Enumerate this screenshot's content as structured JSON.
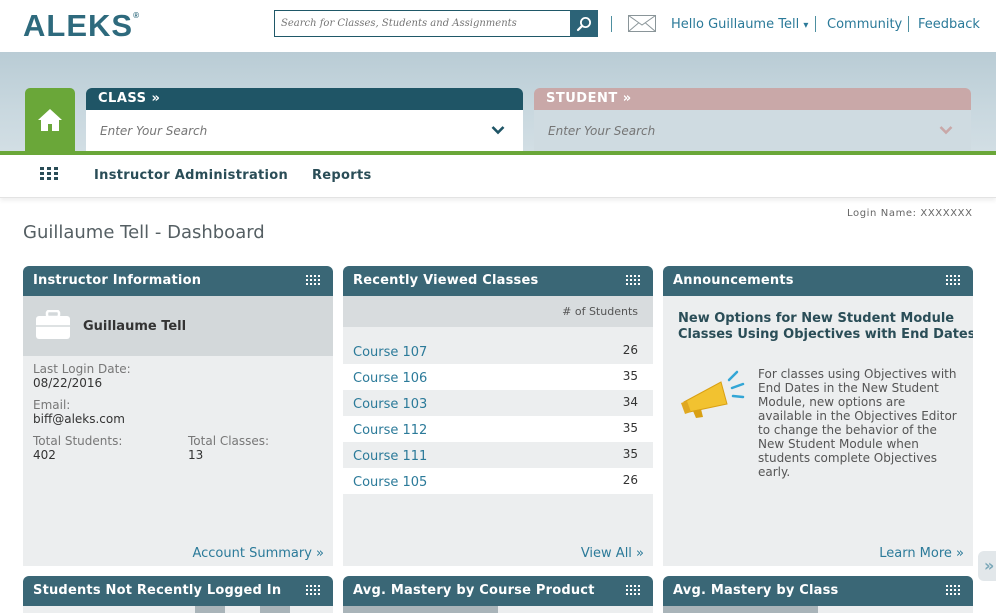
{
  "header": {
    "logo": "ALEKS",
    "logo_mark": "®",
    "search_placeholder": "Search for Classes, Students and Assignments",
    "greeting": "Hello Guillaume Tell",
    "greeting_caret": "▾",
    "community": "Community",
    "feedback": "Feedback"
  },
  "banner": {
    "class_label": "CLASS »",
    "class_placeholder": "Enter Your Search",
    "student_label": "STUDENT »",
    "student_placeholder": "Enter Your Search"
  },
  "nav": {
    "items": [
      "Instructor Administration",
      "Reports"
    ]
  },
  "login_name": "Login Name: XXXXXXX",
  "page_title": "Guillaume Tell - Dashboard",
  "instructor_panel": {
    "title": "Instructor Information",
    "name": "Guillaume Tell",
    "last_login_label": "Last Login Date:",
    "last_login_value": "08/22/2016",
    "email_label": "Email:",
    "email_value": "biff@aleks.com",
    "total_students_label": "Total Students:",
    "total_students_value": "402",
    "total_classes_label": "Total Classes:",
    "total_classes_value": "13",
    "footer_link": "Account Summary »"
  },
  "classes_panel": {
    "title": "Recently Viewed Classes",
    "column_header": "# of Students",
    "rows": [
      {
        "name": "Course 107",
        "count": "26"
      },
      {
        "name": "Course 106",
        "count": "35"
      },
      {
        "name": "Course 103",
        "count": "34"
      },
      {
        "name": "Course 112",
        "count": "35"
      },
      {
        "name": "Course 111",
        "count": "35"
      },
      {
        "name": "Course 105",
        "count": "26"
      }
    ],
    "footer_link": "View All »"
  },
  "announcements_panel": {
    "title": "Announcements",
    "headline": "New Options for New Student Module Classes Using Objectives with End Dates",
    "body": "For classes using Objectives with End Dates in the New Student Module, new options are available in the Objectives Editor to change the behavior of the New Student Module when students complete Objectives early.",
    "footer_link": "Learn More »"
  },
  "bottom_panels": [
    {
      "title": "Students Not Recently Logged In"
    },
    {
      "title": "Avg. Mastery by Course Product"
    },
    {
      "title": "Avg. Mastery by Class"
    }
  ],
  "side_tab": "»",
  "colors": {
    "brand": "#2e6a7d",
    "panel_header": "#3a6776",
    "accent_green": "#6aa739",
    "link": "#2b7a99",
    "student_tab": "#c9a8a8"
  }
}
